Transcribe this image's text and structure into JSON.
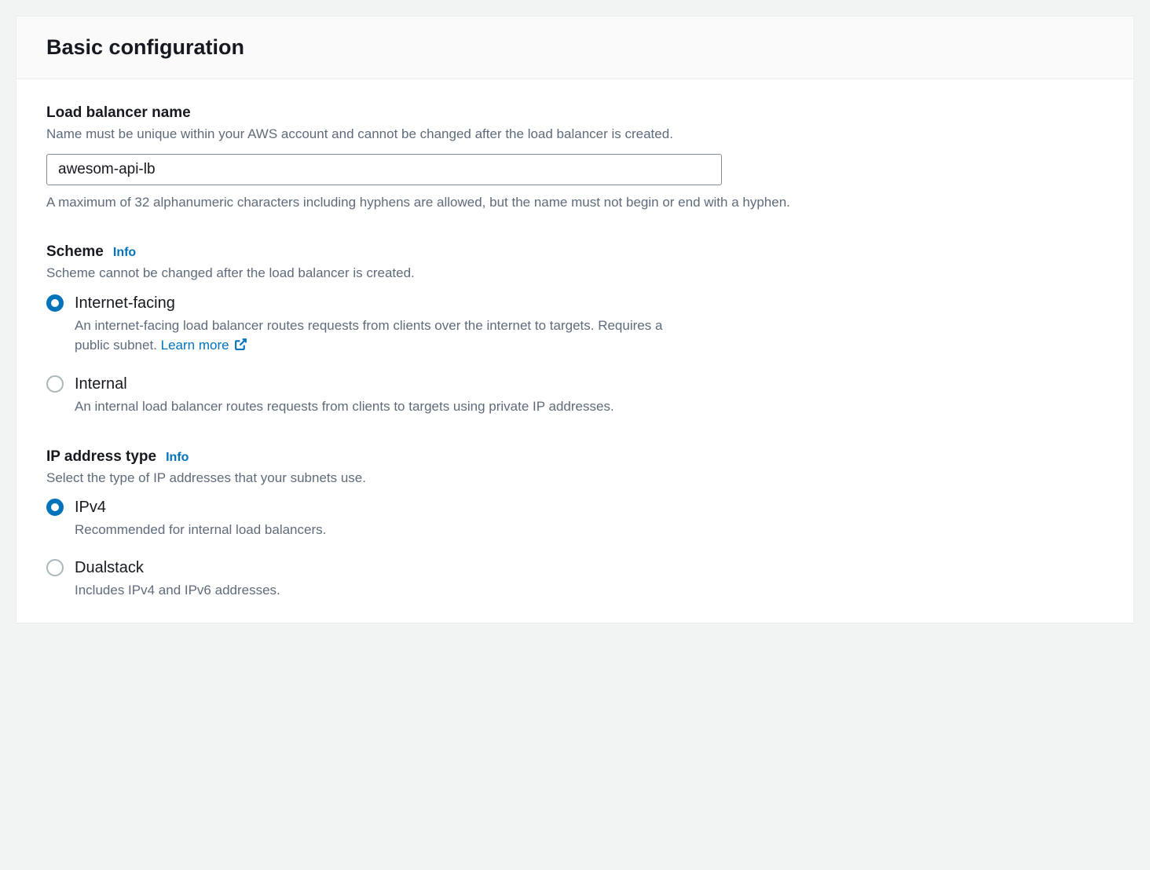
{
  "panel": {
    "title": "Basic configuration"
  },
  "lbName": {
    "label": "Load balancer name",
    "description": "Name must be unique within your AWS account and cannot be changed after the load balancer is created.",
    "value": "awesom-api-lb",
    "constraint": "A maximum of 32 alphanumeric characters including hyphens are allowed, but the name must not begin or end with a hyphen."
  },
  "scheme": {
    "label": "Scheme",
    "infoLink": "Info",
    "description": "Scheme cannot be changed after the load balancer is created.",
    "options": [
      {
        "label": "Internet-facing",
        "description": "An internet-facing load balancer routes requests from clients over the internet to targets. Requires a public subnet. ",
        "learnMore": "Learn more ",
        "checked": true
      },
      {
        "label": "Internal",
        "description": "An internal load balancer routes requests from clients to targets using private IP addresses.",
        "checked": false
      }
    ]
  },
  "ipType": {
    "label": "IP address type",
    "infoLink": "Info",
    "description": "Select the type of IP addresses that your subnets use.",
    "options": [
      {
        "label": "IPv4",
        "description": "Recommended for internal load balancers.",
        "checked": true
      },
      {
        "label": "Dualstack",
        "description": "Includes IPv4 and IPv6 addresses.",
        "checked": false
      }
    ]
  }
}
